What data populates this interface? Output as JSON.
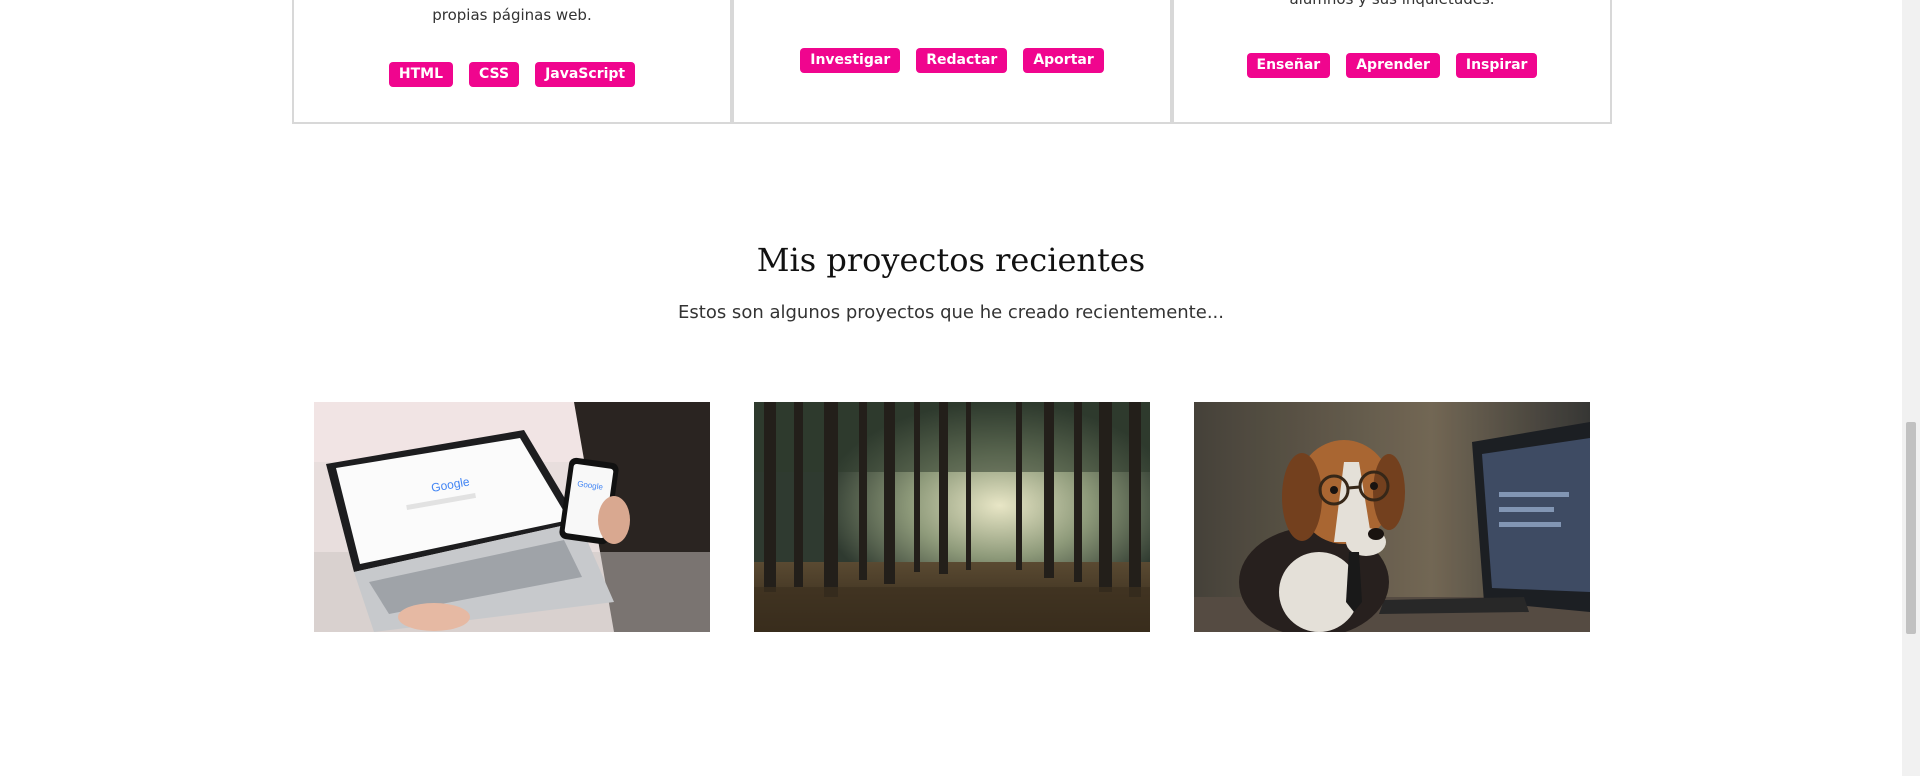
{
  "cards": [
    {
      "text": "propias páginas web.",
      "tags": [
        "HTML",
        "CSS",
        "JavaScript"
      ]
    },
    {
      "text": "",
      "tags": [
        "Investigar",
        "Redactar",
        "Aportar"
      ]
    },
    {
      "text": "alumnos y sus inquietudes.",
      "tags": [
        "Enseñar",
        "Aprender",
        "Inspirar"
      ]
    }
  ],
  "projects_section": {
    "title": "Mis proyectos recientes",
    "subtitle": "Estos son algunos proyectos que he creado recientemente..."
  },
  "projects": [
    {
      "image": "laptop-phone-google-image"
    },
    {
      "image": "forest-image"
    },
    {
      "image": "beagle-computer-image"
    }
  ],
  "colors": {
    "accent": "#f0058e",
    "border": "#d8d8d8"
  }
}
